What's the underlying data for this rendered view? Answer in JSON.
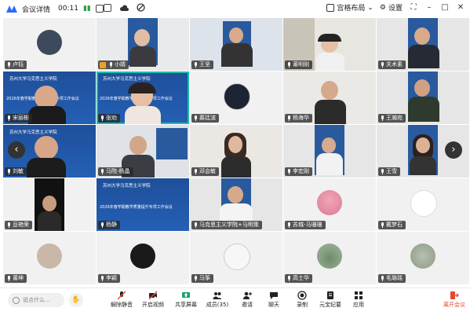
{
  "topbar": {
    "title": "会议详情",
    "time": "00:11",
    "layout_label": "宫格布局",
    "settings_label": "设置"
  },
  "participants": [
    {
      "name": "卢钰",
      "kind": "avatar"
    },
    {
      "name": "小婧",
      "kind": "video",
      "host": true
    },
    {
      "name": "王坚",
      "kind": "video"
    },
    {
      "name": "莆明刚",
      "kind": "video"
    },
    {
      "name": "关术素",
      "kind": "video"
    },
    {
      "name": "宋丽彬",
      "kind": "slide"
    },
    {
      "name": "张劝",
      "kind": "slide",
      "active": true
    },
    {
      "name": "慕廷滨",
      "kind": "avatar"
    },
    {
      "name": "杨海华",
      "kind": "video"
    },
    {
      "name": "王瀚宛",
      "kind": "video"
    },
    {
      "name": "刘敏",
      "kind": "slide"
    },
    {
      "name": "马院-杨晶",
      "kind": "video"
    },
    {
      "name": "邓会敏",
      "kind": "video"
    },
    {
      "name": "李宏刚",
      "kind": "video"
    },
    {
      "name": "王雪",
      "kind": "video"
    },
    {
      "name": "亘艳荣",
      "kind": "video"
    },
    {
      "name": "杨静",
      "kind": "slide"
    },
    {
      "name": "马克思主义学院+马明策",
      "kind": "video"
    },
    {
      "name": "苏城-马珊珊",
      "kind": "avatar"
    },
    {
      "name": "戴梦石",
      "kind": "avatar"
    },
    {
      "name": "莆坤",
      "kind": "avatar"
    },
    {
      "name": "李颖",
      "kind": "avatar"
    },
    {
      "name": "马筝",
      "kind": "avatar"
    },
    {
      "name": "高士华",
      "kind": "avatar"
    },
    {
      "name": "毛璐瑶",
      "kind": "avatar"
    }
  ],
  "slide": {
    "school": "苏州大学马克思主义学院",
    "title": "2026年春学期教学质量提升专项工作会议"
  },
  "toolbar": {
    "chat_placeholder": "说点什么...",
    "mute": "解除静音",
    "video": "开启视频",
    "share": "共享屏幕",
    "members": "成员(35)",
    "invite": "邀请",
    "chat": "聊天",
    "record": "录制",
    "minutes": "元宝纪要",
    "apps": "应用",
    "leave": "离开会议"
  },
  "colors": {
    "accent": "#19c0a8",
    "leave": "#e64a2e",
    "slide_blue": "#2460b5"
  }
}
